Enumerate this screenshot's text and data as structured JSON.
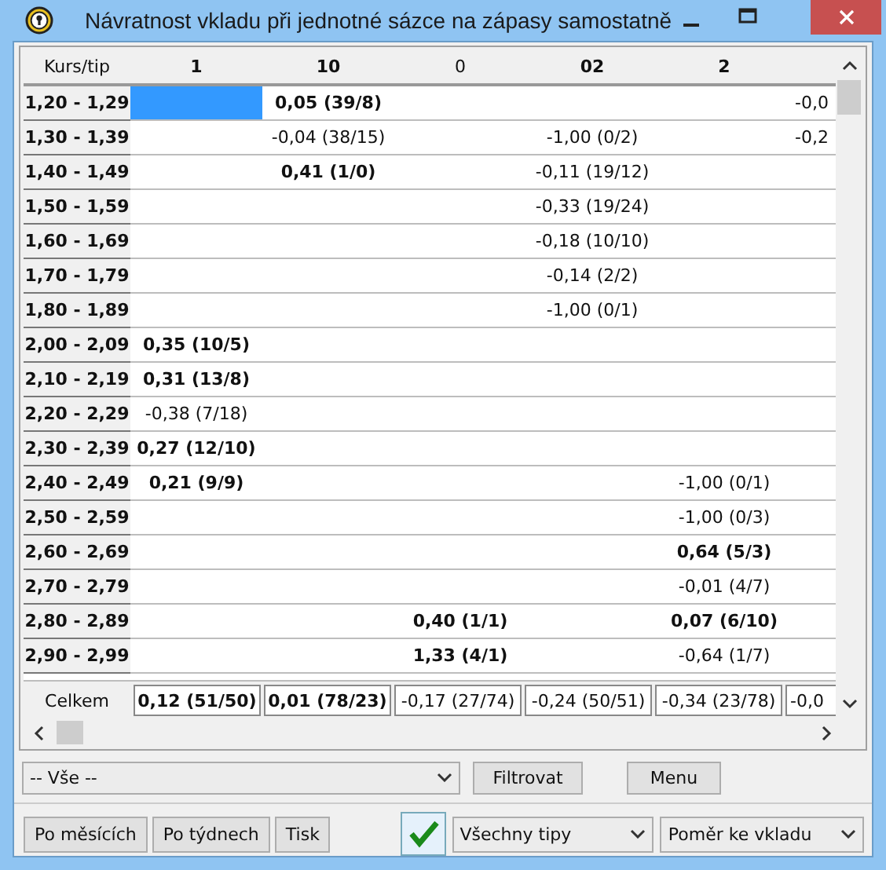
{
  "window": {
    "title": "Návratnost vkladu při jednotné sázce na zápasy samostatně"
  },
  "table": {
    "corner": "Kurs/tip",
    "columns": [
      {
        "label": "1",
        "bold": true
      },
      {
        "label": "10",
        "bold": true
      },
      {
        "label": "0",
        "bold": false
      },
      {
        "label": "02",
        "bold": true
      },
      {
        "label": "2",
        "bold": true
      }
    ],
    "rows": [
      {
        "label": "1,20 - 1,29",
        "cells": [
          {
            "selected": true
          },
          {
            "text": "0,05 (39/8)",
            "bold": true,
            "selected": false
          },
          null,
          null,
          null,
          {
            "text": "-0,0",
            "bold": false,
            "selected": false
          }
        ]
      },
      {
        "label": "1,30 - 1,39",
        "cells": [
          null,
          {
            "text": "-0,04 (38/15)",
            "bold": false,
            "selected": false
          },
          null,
          {
            "text": "-1,00 (0/2)",
            "bold": false,
            "selected": false
          },
          null,
          {
            "text": "-0,2",
            "bold": false,
            "selected": false
          }
        ]
      },
      {
        "label": "1,40 - 1,49",
        "cells": [
          null,
          {
            "text": "0,41 (1/0)",
            "bold": true,
            "selected": false
          },
          null,
          {
            "text": "-0,11 (19/12)",
            "bold": false,
            "selected": false
          },
          null,
          null
        ]
      },
      {
        "label": "1,50 - 1,59",
        "cells": [
          null,
          null,
          null,
          {
            "text": "-0,33 (19/24)",
            "bold": false,
            "selected": false
          },
          null,
          null
        ]
      },
      {
        "label": "1,60 - 1,69",
        "cells": [
          null,
          null,
          null,
          {
            "text": "-0,18 (10/10)",
            "bold": false,
            "selected": false
          },
          null,
          null
        ]
      },
      {
        "label": "1,70 - 1,79",
        "cells": [
          null,
          null,
          null,
          {
            "text": "-0,14 (2/2)",
            "bold": false,
            "selected": false
          },
          null,
          null
        ]
      },
      {
        "label": "1,80 - 1,89",
        "cells": [
          null,
          null,
          null,
          {
            "text": "-1,00 (0/1)",
            "bold": false,
            "selected": false
          },
          null,
          null
        ]
      },
      {
        "label": "2,00 - 2,09",
        "cells": [
          {
            "text": "0,35 (10/5)",
            "bold": true,
            "selected": false
          },
          null,
          null,
          null,
          null,
          null
        ]
      },
      {
        "label": "2,10 - 2,19",
        "cells": [
          {
            "text": "0,31 (13/8)",
            "bold": true,
            "selected": false
          },
          null,
          null,
          null,
          null,
          null
        ]
      },
      {
        "label": "2,20 - 2,29",
        "cells": [
          {
            "text": "-0,38 (7/18)",
            "bold": false,
            "selected": false
          },
          null,
          null,
          null,
          null,
          null
        ]
      },
      {
        "label": "2,30 - 2,39",
        "cells": [
          {
            "text": "0,27 (12/10)",
            "bold": true,
            "selected": false
          },
          null,
          null,
          null,
          null,
          null
        ]
      },
      {
        "label": "2,40 - 2,49",
        "cells": [
          {
            "text": "0,21 (9/9)",
            "bold": true,
            "selected": false
          },
          null,
          null,
          null,
          {
            "text": "-1,00 (0/1)",
            "bold": false,
            "selected": false
          },
          null
        ]
      },
      {
        "label": "2,50 - 2,59",
        "cells": [
          null,
          null,
          null,
          null,
          {
            "text": "-1,00 (0/3)",
            "bold": false,
            "selected": false
          },
          null
        ]
      },
      {
        "label": "2,60 - 2,69",
        "cells": [
          null,
          null,
          null,
          null,
          {
            "text": "0,64 (5/3)",
            "bold": true,
            "selected": false
          },
          null
        ]
      },
      {
        "label": "2,70 - 2,79",
        "cells": [
          null,
          null,
          null,
          null,
          {
            "text": "-0,01 (4/7)",
            "bold": false,
            "selected": false
          },
          null
        ]
      },
      {
        "label": "2,80 - 2,89",
        "cells": [
          null,
          null,
          {
            "text": "0,40 (1/1)",
            "bold": true,
            "selected": false
          },
          null,
          {
            "text": "0,07 (6/10)",
            "bold": true,
            "selected": false
          },
          null
        ]
      },
      {
        "label": "2,90 - 2,99",
        "cells": [
          null,
          null,
          {
            "text": "1,33 (4/1)",
            "bold": true,
            "selected": false
          },
          null,
          {
            "text": "-0,64 (1/7)",
            "bold": false,
            "selected": false
          },
          null
        ]
      }
    ],
    "totals": {
      "label": "Celkem",
      "cells": [
        {
          "text": "0,12 (51/50)",
          "bold": true
        },
        {
          "text": "0,01 (78/23)",
          "bold": true
        },
        {
          "text": "-0,17 (27/74)",
          "bold": false
        },
        {
          "text": "-0,24 (50/51)",
          "bold": false
        },
        {
          "text": "-0,34 (23/78)",
          "bold": false
        },
        {
          "text": "-0,0",
          "bold": false
        }
      ]
    }
  },
  "filter": {
    "value": "-- Vše --"
  },
  "buttons": [
    "Filtrovat",
    "Menu"
  ],
  "bottom_buttons": [
    "Po měsících",
    "Po týdnech",
    "Tisk"
  ],
  "check_toggle": {
    "checked": true
  },
  "tips_select": {
    "value": "Všechny tipy"
  },
  "mode_select": {
    "value": "Poměr ke vkladu"
  }
}
